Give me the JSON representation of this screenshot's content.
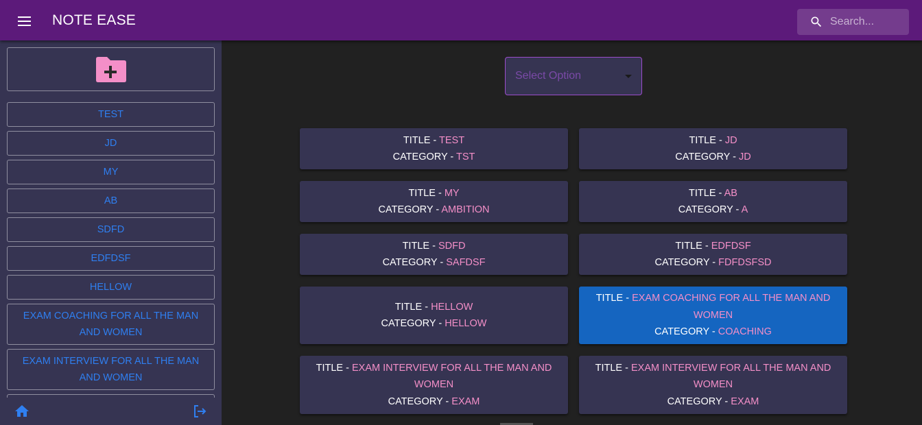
{
  "appbar": {
    "title": "NOTE EASE",
    "search_placeholder": "Search..."
  },
  "sidebar": {
    "notes": [
      "TEST",
      "JD",
      "MY",
      "AB",
      "SDFD",
      "EDFDSF",
      "HELLOW",
      "EXAM COACHING FOR ALL THE MAN AND WOMEN",
      "EXAM INTERVIEW FOR ALL THE MAN AND WOMEN"
    ]
  },
  "main": {
    "select_label": "Select Option",
    "title_label": "TITLE",
    "category_label": "CATEGORY",
    "separator": " - ",
    "cards": [
      {
        "title": "TEST",
        "category": "TST"
      },
      {
        "title": "JD",
        "category": "JD"
      },
      {
        "title": "MY",
        "category": "AMBITION"
      },
      {
        "title": "AB",
        "category": "A"
      },
      {
        "title": "SDFD",
        "category": "SAFDSF"
      },
      {
        "title": "EDFDSF",
        "category": "FDFDSFSD"
      },
      {
        "title": "HELLOW",
        "category": "HELLOW"
      },
      {
        "title": "EXAM COACHING FOR ALL THE MAN AND WOMEN",
        "category": "COACHING"
      },
      {
        "title": "EXAM INTERVIEW FOR ALL THE MAN AND WOMEN",
        "category": "EXAM"
      },
      {
        "title": "EXAM INTERVIEW FOR ALL THE MAN AND WOMEN",
        "category": "EXAM"
      }
    ]
  },
  "colors": {
    "appbar": "#5c1a7a",
    "sidebar": "#363452",
    "card": "#363452",
    "active_card": "#1565c0",
    "accent_pink": "#f48fc8",
    "link_blue": "#2f7ff0"
  }
}
